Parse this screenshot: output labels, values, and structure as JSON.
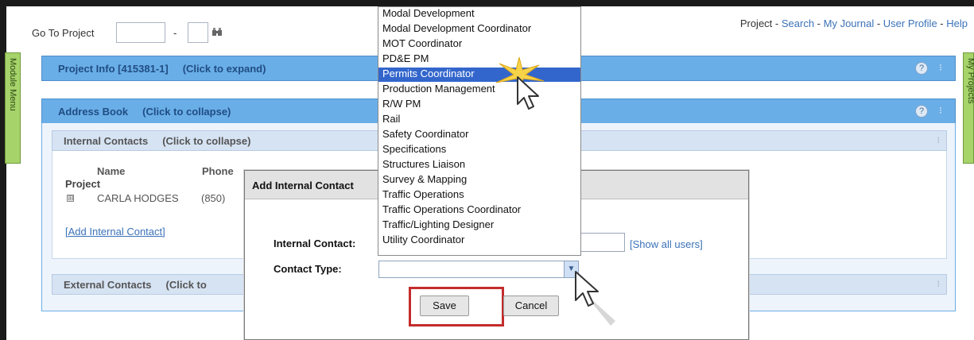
{
  "header": {
    "goto_label": "Go To Project",
    "goto_dash": "-",
    "nav": [
      "Project",
      "Search",
      "My Journal",
      "User Profile",
      "Help"
    ]
  },
  "side_tabs": {
    "left": "Module Menu",
    "right": "My Projects"
  },
  "panels": {
    "project_info": {
      "title": "Project Info [415381-1]",
      "hint": "(Click to expand)"
    },
    "address_book": {
      "title": "Address Book",
      "hint": "(Click to collapse)"
    }
  },
  "internal_contacts": {
    "title": "Internal Contacts",
    "hint": "(Click to collapse)",
    "columns": [
      "Name",
      "Phone"
    ],
    "group": "Project",
    "contact_name": "CARLA HODGES",
    "contact_phone": "(850)",
    "add_link": "[Add Internal Contact]"
  },
  "external_contacts": {
    "title": "External Contacts",
    "hint": "(Click to"
  },
  "dialog": {
    "title": "Add Internal Contact",
    "internal_contact_label": "Internal Contact:",
    "contact_type_label": "Contact Type:",
    "show_all_users": "[Show all users]",
    "save_label": "Save",
    "cancel_label": "Cancel"
  },
  "dropdown": {
    "selected": "Permits Coordinator",
    "options": [
      "Modal Development",
      "Modal Development Coordinator",
      "MOT Coordinator",
      "PD&E PM",
      "Permits Coordinator",
      "Production Management",
      "R/W PM",
      "Rail",
      "Safety Coordinator",
      "Specifications",
      "Structures Liaison",
      "Survey & Mapping",
      "Traffic Operations",
      "Traffic Operations Coordinator",
      "Traffic/Lighting Designer",
      "Utility Coordinator"
    ]
  },
  "icons": {
    "help": "?",
    "expand": "⊞",
    "select_arrow": "▼"
  },
  "colors": {
    "panel_bar": "#6aaee8",
    "selection": "#3366cc",
    "link": "#3b72b8",
    "highlight": "#c42c2c"
  }
}
